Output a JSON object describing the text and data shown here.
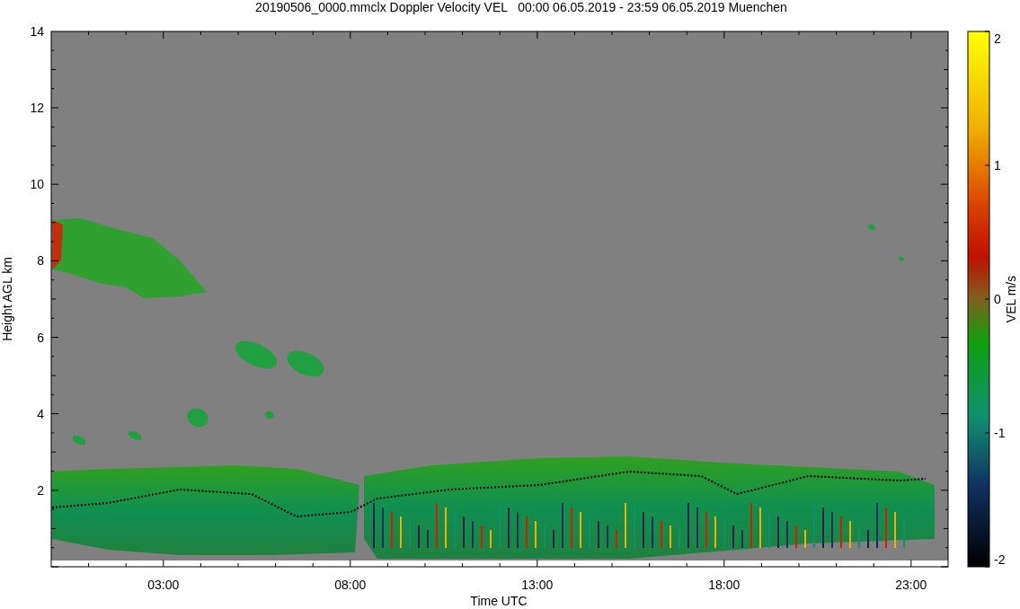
{
  "title": "20190506_0000.mmclx Doppler Velocity VEL   00:00 06.05.2019 - 23:59 06.05.2019 Muenchen",
  "y_axis": {
    "label": "Height AGL km",
    "ticks": [
      "14",
      "12",
      "10",
      "8",
      "6",
      "4",
      "2"
    ]
  },
  "x_axis": {
    "label": "Time UTC",
    "ticks": [
      "03:00",
      "08:00",
      "13:00",
      "18:00",
      "23:00"
    ]
  },
  "colorbar": {
    "label": "VEL m/s",
    "ticks": [
      "2",
      "1",
      "0",
      "-1",
      "-2"
    ]
  }
}
